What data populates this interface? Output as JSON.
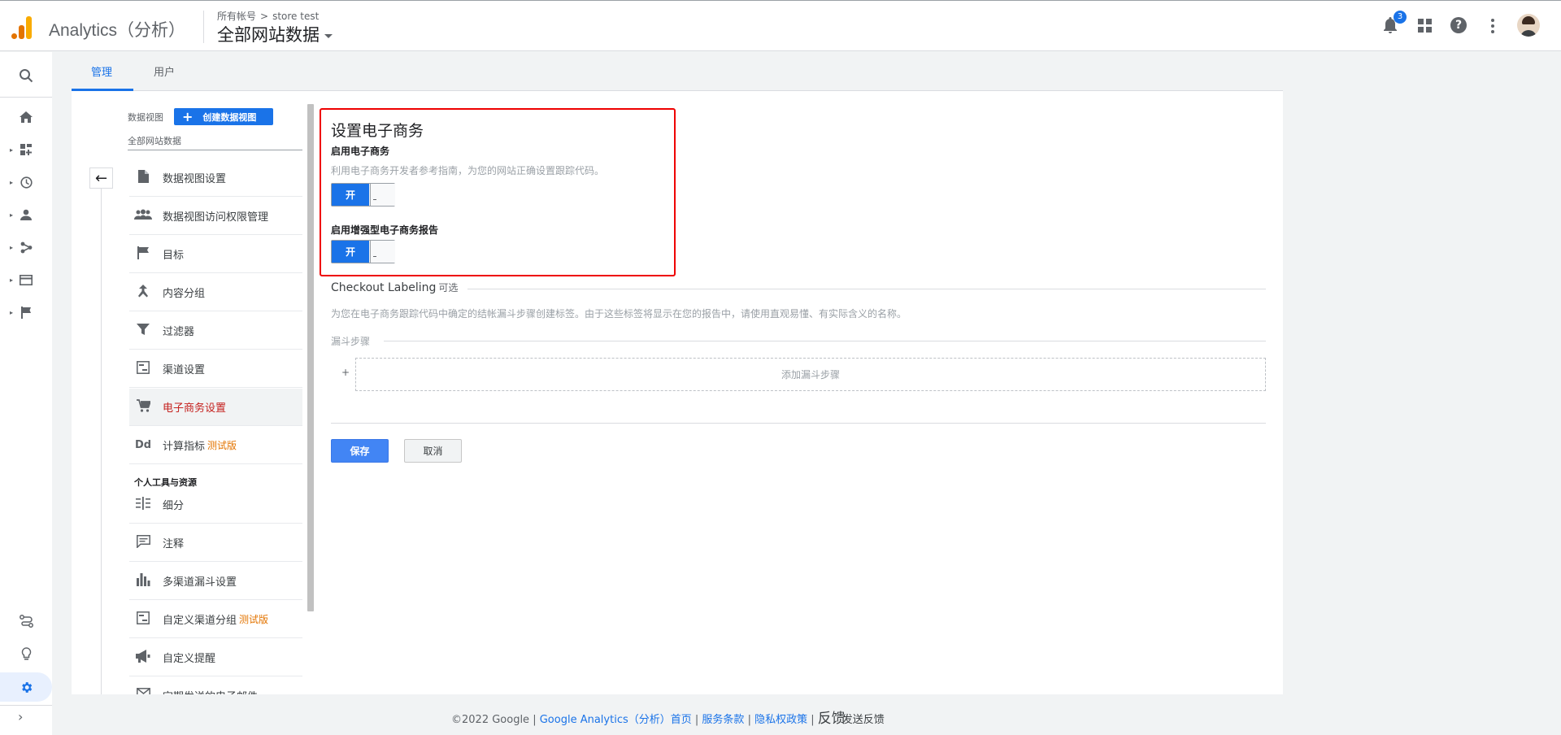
{
  "header": {
    "app_title": "Analytics（分析）",
    "breadcrumb_all": "所有帐号",
    "breadcrumb_sep": ">",
    "breadcrumb_account": "store test",
    "property": "全部网站数据",
    "notification_count": "3"
  },
  "tabs": [
    {
      "label": "管理",
      "active": true
    },
    {
      "label": "用户",
      "active": false
    }
  ],
  "view_column": {
    "label": "数据视图",
    "create_button": "创建数据视图",
    "view_name": "全部网站数据",
    "section_head": "个人工具与资源",
    "beta_label": "测试版",
    "items": [
      {
        "label": "数据视图设置",
        "icon": "document-icon"
      },
      {
        "label": "数据视图访问权限管理",
        "icon": "people-icon"
      },
      {
        "label": "目标",
        "icon": "flag-icon"
      },
      {
        "label": "内容分组",
        "icon": "content-grouping-icon"
      },
      {
        "label": "过滤器",
        "icon": "filter-icon"
      },
      {
        "label": "渠道设置",
        "icon": "channel-settings-icon"
      },
      {
        "label": "电子商务设置",
        "icon": "cart-icon"
      },
      {
        "label": "计算指标",
        "icon": "calculated-metrics-icon",
        "badge_text": "Dd"
      },
      {
        "label": "细分",
        "icon": "segments-icon"
      },
      {
        "label": "注释",
        "icon": "annotations-icon"
      },
      {
        "label": "多渠道漏斗设置",
        "icon": "bar-chart-icon"
      },
      {
        "label": "自定义渠道分组",
        "icon": "custom-channel-icon"
      },
      {
        "label": "自定义提醒",
        "icon": "megaphone-icon"
      },
      {
        "label": "定期发送的电子邮件",
        "icon": "scheduled-email-icon"
      }
    ]
  },
  "ecommerce": {
    "title": "设置电子商务",
    "enable_label": "启用电子商务",
    "enable_desc": "利用电子商务开发者参考指南，为您的网站正确设置跟踪代码。",
    "toggle_on": "开",
    "enhanced_label": "启用增强型电子商务报告",
    "checkout_title": "Checkout Labeling",
    "checkout_optional": "可选",
    "checkout_desc": "为您在电子商务跟踪代码中确定的结帐漏斗步骤创建标签。由于这些标签将显示在您的报告中，请使用直观易懂、有实际含义的名称。",
    "funnel_label": "漏斗步骤",
    "add_step_plus": "+",
    "add_step": "添加漏斗步骤",
    "save": "保存",
    "cancel": "取消"
  },
  "footer": {
    "copyright": "©2022 Google",
    "sep": "|",
    "home": "Google Analytics（分析）首页",
    "terms": "服务条款",
    "privacy": "隐私权政策",
    "feedback_a": "反馈",
    "feedback_b": "发送反馈"
  },
  "colors": {
    "accent": "#1a73e8",
    "highlight_border": "#e00000",
    "active_item": "#c5221f",
    "beta": "#e37400"
  }
}
